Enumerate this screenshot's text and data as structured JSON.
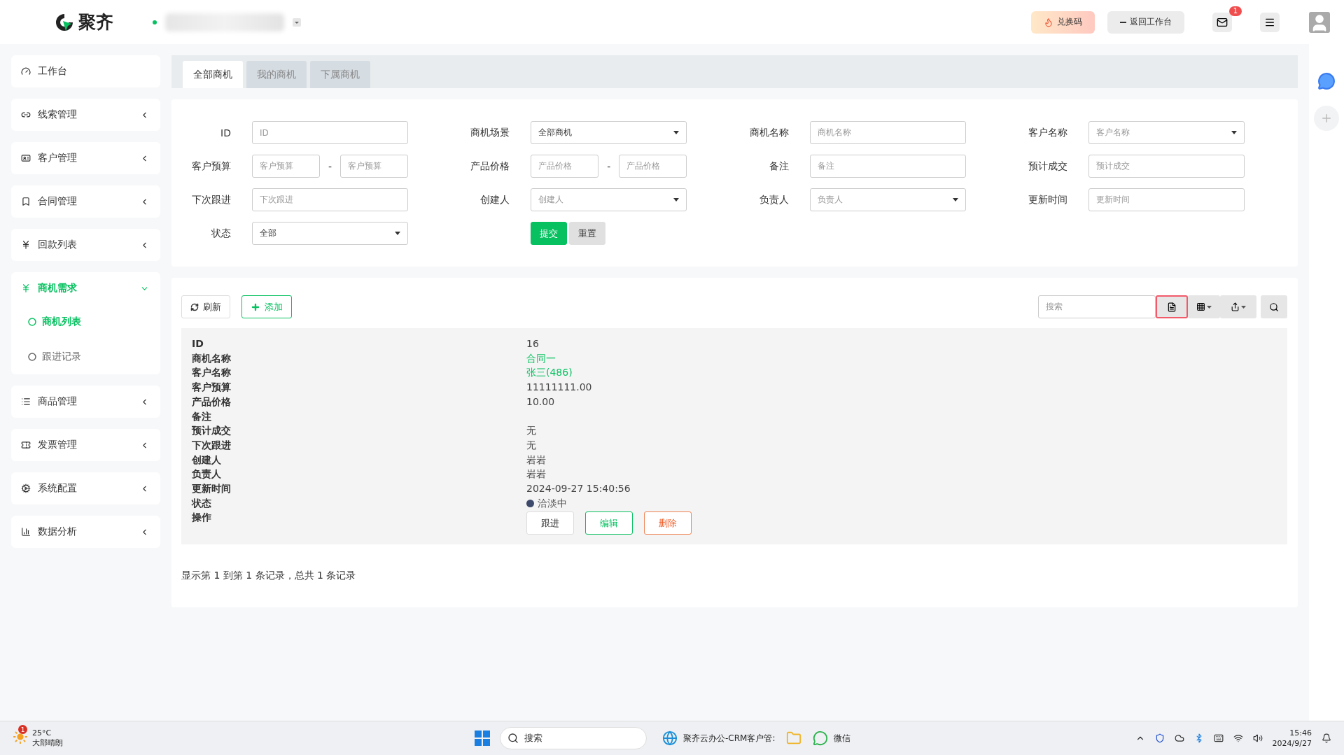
{
  "header": {
    "logo": "聚齐",
    "redeem_button": "兑换码",
    "back_button": "返回工作台",
    "mail_badge": "1"
  },
  "sidebar": {
    "items": [
      {
        "label": "工作台",
        "expanded": false,
        "has_arrow": false
      },
      {
        "label": "线索管理",
        "expanded": false,
        "has_arrow": true
      },
      {
        "label": "客户管理",
        "expanded": false,
        "has_arrow": true
      },
      {
        "label": "合同管理",
        "expanded": false,
        "has_arrow": true
      },
      {
        "label": "回款列表",
        "expanded": false,
        "has_arrow": true
      },
      {
        "label": "商机需求",
        "expanded": true,
        "has_arrow": true,
        "children": [
          {
            "label": "商机列表",
            "selected": true
          },
          {
            "label": "跟进记录",
            "selected": false
          }
        ]
      },
      {
        "label": "商品管理",
        "expanded": false,
        "has_arrow": true
      },
      {
        "label": "发票管理",
        "expanded": false,
        "has_arrow": true
      },
      {
        "label": "系统配置",
        "expanded": false,
        "has_arrow": true
      },
      {
        "label": "数据分析",
        "expanded": false,
        "has_arrow": true
      }
    ]
  },
  "tabs": [
    {
      "label": "全部商机",
      "selected": true
    },
    {
      "label": "我的商机",
      "selected": false
    },
    {
      "label": "下属商机",
      "selected": false
    }
  ],
  "filters": [
    {
      "label": "ID",
      "kind": "text",
      "placeholder": "ID"
    },
    {
      "label": "商机场景",
      "kind": "select",
      "value": "全部商机"
    },
    {
      "label": "商机名称",
      "kind": "text",
      "placeholder": "商机名称"
    },
    {
      "label": "客户名称",
      "kind": "select",
      "placeholder": "客户名称"
    },
    {
      "label": "客户预算",
      "kind": "range",
      "placeholders": [
        "客户预算",
        "客户预算"
      ],
      "separator": "-"
    },
    {
      "label": "产品价格",
      "kind": "range",
      "placeholders": [
        "产品价格",
        "产品价格"
      ],
      "separator": "-"
    },
    {
      "label": "备注",
      "kind": "text",
      "placeholder": "备注"
    },
    {
      "label": "预计成交",
      "kind": "text",
      "placeholder": "预计成交"
    },
    {
      "label": "下次跟进",
      "kind": "text",
      "placeholder": "下次跟进"
    },
    {
      "label": "创建人",
      "kind": "select",
      "placeholder": "创建人"
    },
    {
      "label": "负责人",
      "kind": "select",
      "placeholder": "负责人"
    },
    {
      "label": "更新时间",
      "kind": "text",
      "placeholder": "更新时间"
    },
    {
      "label": "状态",
      "kind": "select",
      "value": "全部"
    }
  ],
  "filter_actions": {
    "submit": "提交",
    "reset": "重置"
  },
  "toolbar": {
    "refresh": "刷新",
    "add": "添加",
    "search_placeholder": "搜索",
    "card_view_selected": true
  },
  "record": [
    {
      "label": "ID",
      "kind": "text",
      "value": "16"
    },
    {
      "label": "商机名称",
      "kind": "link",
      "value": "合同一"
    },
    {
      "label": "客户名称",
      "kind": "link",
      "value": "张三(486)"
    },
    {
      "label": "客户预算",
      "kind": "text",
      "value": "11111111.00"
    },
    {
      "label": "产品价格",
      "kind": "text",
      "value": "10.00"
    },
    {
      "label": "备注",
      "kind": "text"
    },
    {
      "label": "预计成交",
      "kind": "text",
      "value": "无"
    },
    {
      "label": "下次跟进",
      "kind": "text",
      "value": "无"
    },
    {
      "label": "创建人",
      "kind": "text",
      "value": "岩岩"
    },
    {
      "label": "负责人",
      "kind": "text",
      "value": "岩岩"
    },
    {
      "label": "更新时间",
      "kind": "text",
      "value": "2024-09-27 15:40:56"
    },
    {
      "label": "状态",
      "kind": "status",
      "value": "洽淡中",
      "color": "#3d4a6b"
    },
    {
      "label": "操作",
      "kind": "actions",
      "buttons": [
        {
          "label": "跟进",
          "kind": "default"
        },
        {
          "label": "编辑",
          "kind": "primary"
        },
        {
          "label": "删除",
          "kind": "danger"
        }
      ]
    }
  ],
  "pagination": "显示第 1 到第 1 条记录，总共 1 条记录",
  "taskbar": {
    "weather_badge": "1",
    "temperature": "25°C",
    "weather": "大部晴朗",
    "search": "搜索",
    "apps": [
      {
        "label": "聚齐云办公-CRM客户管:",
        "kind": "browser"
      },
      {
        "kind": "folder"
      },
      {
        "label": "微信",
        "kind": "chat"
      }
    ],
    "time": "15:46",
    "date": "2024/9/27"
  }
}
